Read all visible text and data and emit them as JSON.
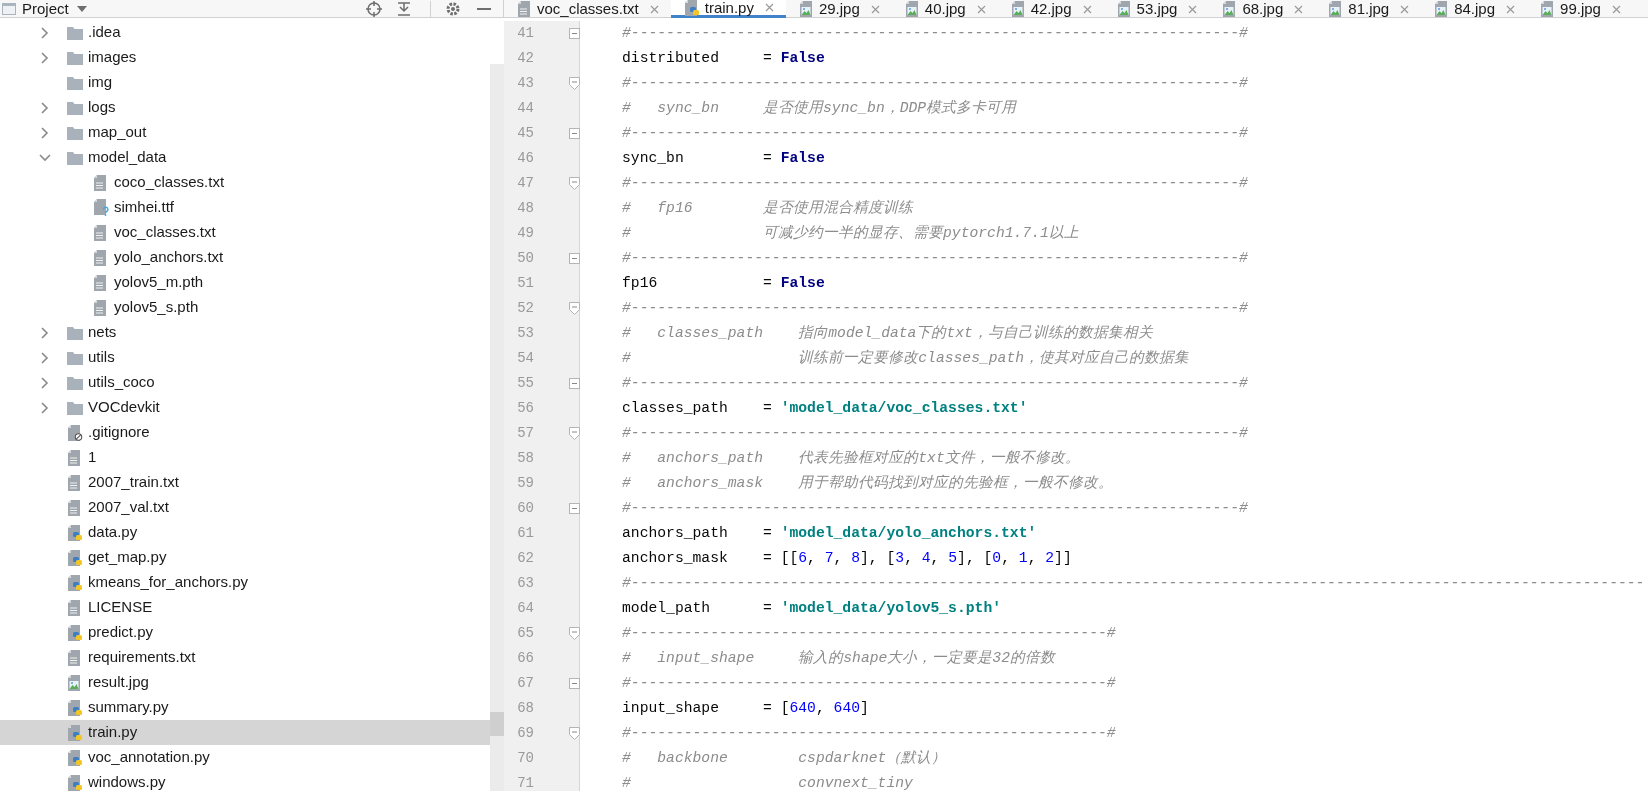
{
  "project_panel": {
    "title": "Project",
    "tree": [
      {
        "name": ".idea",
        "kind": "folder",
        "expanded": false,
        "selected": false
      },
      {
        "name": "images",
        "kind": "folder",
        "expanded": false,
        "selected": false
      },
      {
        "name": "img",
        "kind": "empty_folder",
        "selected": false
      },
      {
        "name": "logs",
        "kind": "folder",
        "expanded": false,
        "selected": false
      },
      {
        "name": "map_out",
        "kind": "folder",
        "expanded": false,
        "selected": false
      },
      {
        "name": "model_data",
        "kind": "folder",
        "expanded": true,
        "selected": false,
        "children": [
          {
            "name": "coco_classes.txt",
            "kind": "text",
            "selected": false
          },
          {
            "name": "simhei.ttf",
            "kind": "unknown",
            "selected": false
          },
          {
            "name": "voc_classes.txt",
            "kind": "text",
            "selected": false
          },
          {
            "name": "yolo_anchors.txt",
            "kind": "text",
            "selected": false
          },
          {
            "name": "yolov5_m.pth",
            "kind": "text",
            "selected": false
          },
          {
            "name": "yolov5_s.pth",
            "kind": "text",
            "selected": false
          }
        ]
      },
      {
        "name": "nets",
        "kind": "folder",
        "expanded": false,
        "selected": false
      },
      {
        "name": "utils",
        "kind": "folder",
        "expanded": false,
        "selected": false
      },
      {
        "name": "utils_coco",
        "kind": "folder",
        "expanded": false,
        "selected": false
      },
      {
        "name": "VOCdevkit",
        "kind": "folder",
        "expanded": false,
        "selected": false
      },
      {
        "name": ".gitignore",
        "kind": "ignored",
        "selected": false
      },
      {
        "name": "1",
        "kind": "text",
        "selected": false
      },
      {
        "name": "2007_train.txt",
        "kind": "text",
        "selected": false
      },
      {
        "name": "2007_val.txt",
        "kind": "text",
        "selected": false
      },
      {
        "name": "data.py",
        "kind": "python",
        "selected": false
      },
      {
        "name": "get_map.py",
        "kind": "python",
        "selected": false
      },
      {
        "name": "kmeans_for_anchors.py",
        "kind": "python",
        "selected": false
      },
      {
        "name": "LICENSE",
        "kind": "text",
        "selected": false
      },
      {
        "name": "predict.py",
        "kind": "python",
        "selected": false
      },
      {
        "name": "requirements.txt",
        "kind": "text",
        "selected": false
      },
      {
        "name": "result.jpg",
        "kind": "image",
        "selected": false
      },
      {
        "name": "summary.py",
        "kind": "python",
        "selected": false
      },
      {
        "name": "train.py",
        "kind": "python",
        "selected": true
      },
      {
        "name": "voc_annotation.py",
        "kind": "python",
        "selected": false
      },
      {
        "name": "windows.py",
        "kind": "python",
        "selected": false
      }
    ]
  },
  "tabs": [
    {
      "label": "voc_classes.txt",
      "kind": "text",
      "selected": false
    },
    {
      "label": "train.py",
      "kind": "python",
      "selected": true
    },
    {
      "label": "29.jpg",
      "kind": "image",
      "selected": false
    },
    {
      "label": "40.jpg",
      "kind": "image",
      "selected": false
    },
    {
      "label": "42.jpg",
      "kind": "image",
      "selected": false
    },
    {
      "label": "53.jpg",
      "kind": "image",
      "selected": false
    },
    {
      "label": "68.jpg",
      "kind": "image",
      "selected": false
    },
    {
      "label": "81.jpg",
      "kind": "image",
      "selected": false
    },
    {
      "label": "84.jpg",
      "kind": "image",
      "selected": false
    },
    {
      "label": "99.jpg",
      "kind": "image",
      "selected": false
    }
  ],
  "editor": {
    "lines": [
      {
        "number": "41",
        "fold_marker": {
          "kind": "start"
        },
        "tokens": [
          {
            "kind": "com",
            "text": "#---------------------------------------------------------------------#"
          }
        ]
      },
      {
        "number": "42",
        "tokens": [
          {
            "kind": "plain",
            "text": "distributed     = "
          },
          {
            "kind": "kw",
            "text": "False"
          }
        ]
      },
      {
        "number": "43",
        "fold_marker": {
          "kind": "end"
        },
        "tokens": [
          {
            "kind": "com",
            "text": "#---------------------------------------------------------------------#"
          }
        ]
      },
      {
        "number": "44",
        "tokens": [
          {
            "kind": "com",
            "text": "#   sync_bn     是否使用sync_bn，DDP模式多卡可用"
          }
        ]
      },
      {
        "number": "45",
        "fold_marker": {
          "kind": "start"
        },
        "tokens": [
          {
            "kind": "com",
            "text": "#---------------------------------------------------------------------#"
          }
        ]
      },
      {
        "number": "46",
        "tokens": [
          {
            "kind": "plain",
            "text": "sync_bn         = "
          },
          {
            "kind": "kw",
            "text": "False"
          }
        ]
      },
      {
        "number": "47",
        "fold_marker": {
          "kind": "end"
        },
        "tokens": [
          {
            "kind": "com",
            "text": "#---------------------------------------------------------------------#"
          }
        ]
      },
      {
        "number": "48",
        "tokens": [
          {
            "kind": "com",
            "text": "#   fp16        是否使用混合精度训练"
          }
        ]
      },
      {
        "number": "49",
        "tokens": [
          {
            "kind": "com",
            "text": "#               可减少约一半的显存、需要pytorch1.7.1以上"
          }
        ]
      },
      {
        "number": "50",
        "fold_marker": {
          "kind": "start"
        },
        "tokens": [
          {
            "kind": "com",
            "text": "#---------------------------------------------------------------------#"
          }
        ]
      },
      {
        "number": "51",
        "tokens": [
          {
            "kind": "plain",
            "text": "fp16            = "
          },
          {
            "kind": "kw",
            "text": "False"
          }
        ]
      },
      {
        "number": "52",
        "fold_marker": {
          "kind": "end"
        },
        "tokens": [
          {
            "kind": "com",
            "text": "#---------------------------------------------------------------------#"
          }
        ]
      },
      {
        "number": "53",
        "tokens": [
          {
            "kind": "com",
            "text": "#   classes_path    指向model_data下的txt，与自己训练的数据集相关"
          }
        ]
      },
      {
        "number": "54",
        "tokens": [
          {
            "kind": "com",
            "text": "#                   训练前一定要修改classes_path，使其对应自己的数据集"
          }
        ]
      },
      {
        "number": "55",
        "fold_marker": {
          "kind": "start"
        },
        "tokens": [
          {
            "kind": "com",
            "text": "#---------------------------------------------------------------------#"
          }
        ]
      },
      {
        "number": "56",
        "tokens": [
          {
            "kind": "plain",
            "text": "classes_path    = "
          },
          {
            "kind": "str",
            "text": "'model_data/voc_classes.txt'"
          }
        ]
      },
      {
        "number": "57",
        "fold_marker": {
          "kind": "end"
        },
        "tokens": [
          {
            "kind": "com",
            "text": "#---------------------------------------------------------------------#"
          }
        ]
      },
      {
        "number": "58",
        "tokens": [
          {
            "kind": "com",
            "text": "#   anchors_path    代表先验框对应的txt文件，一般不修改。"
          }
        ]
      },
      {
        "number": "59",
        "tokens": [
          {
            "kind": "com",
            "text": "#   anchors_mask    用于帮助代码找到对应的先验框，一般不修改。"
          }
        ]
      },
      {
        "number": "60",
        "fold_marker": {
          "kind": "start"
        },
        "tokens": [
          {
            "kind": "com",
            "text": "#---------------------------------------------------------------------#"
          }
        ]
      },
      {
        "number": "61",
        "tokens": [
          {
            "kind": "plain",
            "text": "anchors_path    = "
          },
          {
            "kind": "str",
            "text": "'model_data/yolo_anchors.txt'"
          }
        ]
      },
      {
        "number": "62",
        "tokens": [
          {
            "kind": "plain",
            "text": "anchors_mask    = [["
          },
          {
            "kind": "num",
            "text": "6"
          },
          {
            "kind": "plain",
            "text": ", "
          },
          {
            "kind": "num",
            "text": "7"
          },
          {
            "kind": "plain",
            "text": ", "
          },
          {
            "kind": "num",
            "text": "8"
          },
          {
            "kind": "plain",
            "text": "], ["
          },
          {
            "kind": "num",
            "text": "3"
          },
          {
            "kind": "plain",
            "text": ", "
          },
          {
            "kind": "num",
            "text": "4"
          },
          {
            "kind": "plain",
            "text": ", "
          },
          {
            "kind": "num",
            "text": "5"
          },
          {
            "kind": "plain",
            "text": "], ["
          },
          {
            "kind": "num",
            "text": "0"
          },
          {
            "kind": "plain",
            "text": ", "
          },
          {
            "kind": "num",
            "text": "1"
          },
          {
            "kind": "plain",
            "text": ", "
          },
          {
            "kind": "num",
            "text": "2"
          },
          {
            "kind": "plain",
            "text": "]]"
          }
        ]
      },
      {
        "number": "63",
        "tokens": [
          {
            "kind": "com",
            "text": "#-------------------------------------------------------------------------------------------------------------------"
          }
        ]
      },
      {
        "number": "64",
        "tokens": [
          {
            "kind": "plain",
            "text": "model_path      = "
          },
          {
            "kind": "str",
            "text": "'model_data/yolov5_s.pth'"
          }
        ]
      },
      {
        "number": "65",
        "fold_marker": {
          "kind": "end"
        },
        "tokens": [
          {
            "kind": "com",
            "text": "#------------------------------------------------------#"
          }
        ]
      },
      {
        "number": "66",
        "tokens": [
          {
            "kind": "com",
            "text": "#   input_shape     输入的shape大小，一定要是32的倍数"
          }
        ]
      },
      {
        "number": "67",
        "fold_marker": {
          "kind": "start"
        },
        "tokens": [
          {
            "kind": "com",
            "text": "#------------------------------------------------------#"
          }
        ]
      },
      {
        "number": "68",
        "tokens": [
          {
            "kind": "plain",
            "text": "input_shape     = ["
          },
          {
            "kind": "num",
            "text": "640"
          },
          {
            "kind": "plain",
            "text": ", "
          },
          {
            "kind": "num",
            "text": "640"
          },
          {
            "kind": "plain",
            "text": "]"
          }
        ]
      },
      {
        "number": "69",
        "fold_marker": {
          "kind": "end"
        },
        "tokens": [
          {
            "kind": "com",
            "text": "#------------------------------------------------------#"
          }
        ]
      },
      {
        "number": "70",
        "tokens": [
          {
            "kind": "com",
            "text": "#   backbone        cspdarknet（默认）"
          }
        ]
      },
      {
        "number": "71",
        "tokens": [
          {
            "kind": "com",
            "text": "#                   convnext_tiny"
          }
        ]
      }
    ]
  }
}
